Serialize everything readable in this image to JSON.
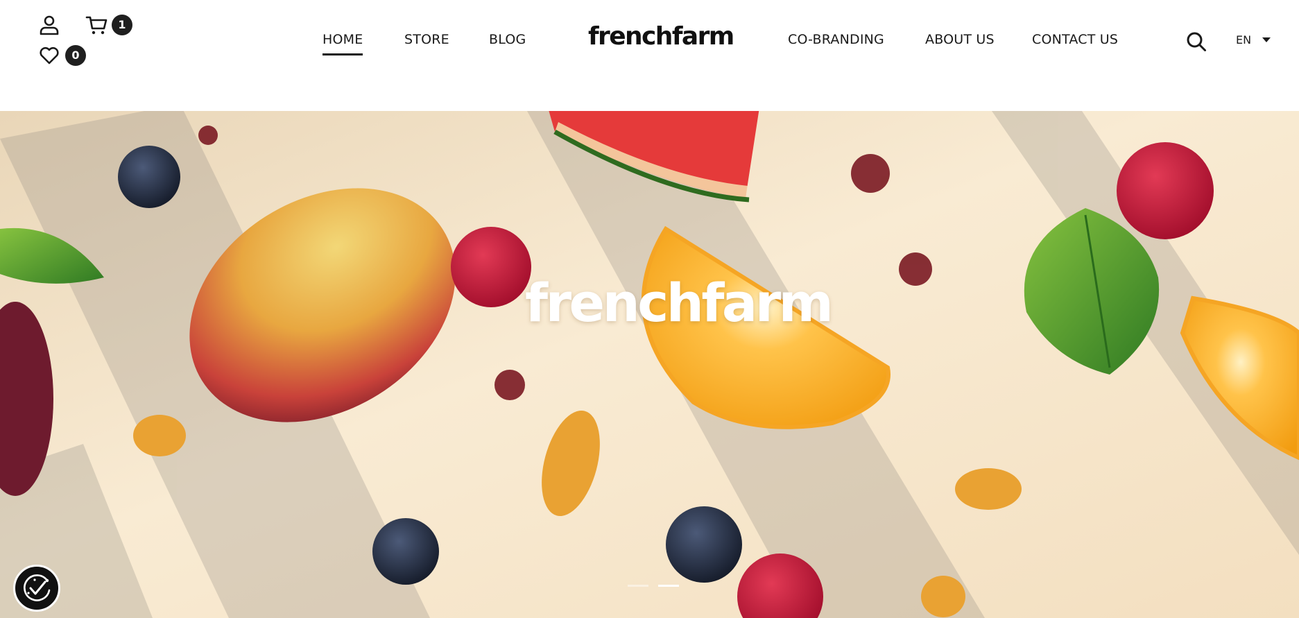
{
  "header": {
    "icons": {
      "account": "user-icon",
      "cart": "cart-icon",
      "wishlist": "heart-icon",
      "search": "search-icon"
    },
    "cart_count": "1",
    "wishlist_count": "0",
    "brand": "frenchfarm",
    "nav": [
      {
        "label": "HOME",
        "active": true
      },
      {
        "label": "STORE"
      },
      {
        "label": "BLOG"
      },
      {
        "label": "CO-BRANDING"
      },
      {
        "label": "ABOUT US"
      },
      {
        "label": "CONTACT US"
      }
    ],
    "language": "EN"
  },
  "hero": {
    "logo": "frenchfarm",
    "slides_total": 2,
    "slide_active": 2
  },
  "consent": {
    "icon": "cookie-consent-icon"
  },
  "colors": {
    "text": "#1a1a1a",
    "badge": "#1f1f1f",
    "hero_bg": "#f6e6cc",
    "white": "#ffffff"
  }
}
